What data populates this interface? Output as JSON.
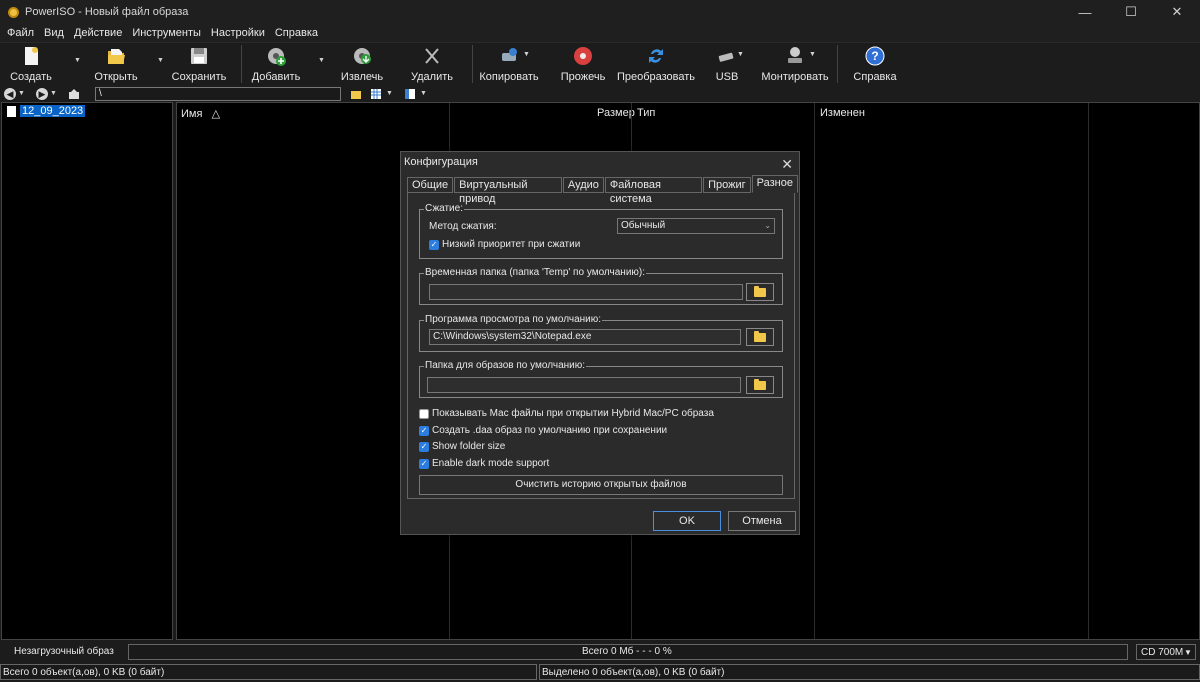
{
  "window": {
    "title": "PowerISO - Новый файл образа"
  },
  "menu": [
    "Файл",
    "Вид",
    "Действие",
    "Инструменты",
    "Настройки",
    "Справка"
  ],
  "toolbar": {
    "create": "Создать",
    "open": "Открыть",
    "save": "Сохранить",
    "add": "Добавить",
    "extract": "Извлечь",
    "delete": "Удалить",
    "copy": "Копировать",
    "burn": "Прожечь",
    "convert": "Преобразовать",
    "usb": "USB",
    "mount": "Монтировать",
    "help": "Справка"
  },
  "address": {
    "path": "\\"
  },
  "tree": {
    "item": "12_09_2023"
  },
  "columns": {
    "name": "Имя",
    "size": "Размер",
    "type": "Тип",
    "modified": "Изменен"
  },
  "status": {
    "boot": "Незагрузочный образ",
    "total": "Всего  0 Мб    - - -  0 %",
    "media": "CD 700M",
    "objects": "Всего 0 объект(а,ов), 0 KB (0 байт)",
    "selected": "Выделено 0 объект(а,ов), 0 KB (0 байт)"
  },
  "dialog": {
    "title": "Конфигурация",
    "tabs": [
      "Общие",
      "Виртуальный привод",
      "Аудио",
      "Файловая система",
      "Прожиг",
      "Разное"
    ],
    "compression": {
      "group": "Сжатие:",
      "method_label": "Метод сжатия:",
      "method_value": "Обычный",
      "low_priority": "Низкий приоритет при сжатии"
    },
    "temp_folder": {
      "group": "Временная папка (папка 'Temp' по умолчанию):",
      "value": ""
    },
    "viewer": {
      "group": "Программа просмотра по умолчанию:",
      "value": "C:\\Windows\\system32\\Notepad.exe"
    },
    "image_folder": {
      "group": "Папка для образов по умолчанию:",
      "value": ""
    },
    "options": [
      {
        "label": "Показывать Mac файлы при открытии Hybrid Mac/PC образа",
        "checked": false
      },
      {
        "label": "Создать .daa образ по умолчанию при сохранении",
        "checked": true
      },
      {
        "label": "Show folder size",
        "checked": true
      },
      {
        "label": "Enable dark mode support",
        "checked": true
      }
    ],
    "clear_history": "Очистить историю открытых файлов",
    "ok": "OK",
    "cancel": "Отмена"
  },
  "colors": {
    "accent": "#2b7de0",
    "selection": "#0a64c8",
    "folder": "#f2c84a"
  }
}
